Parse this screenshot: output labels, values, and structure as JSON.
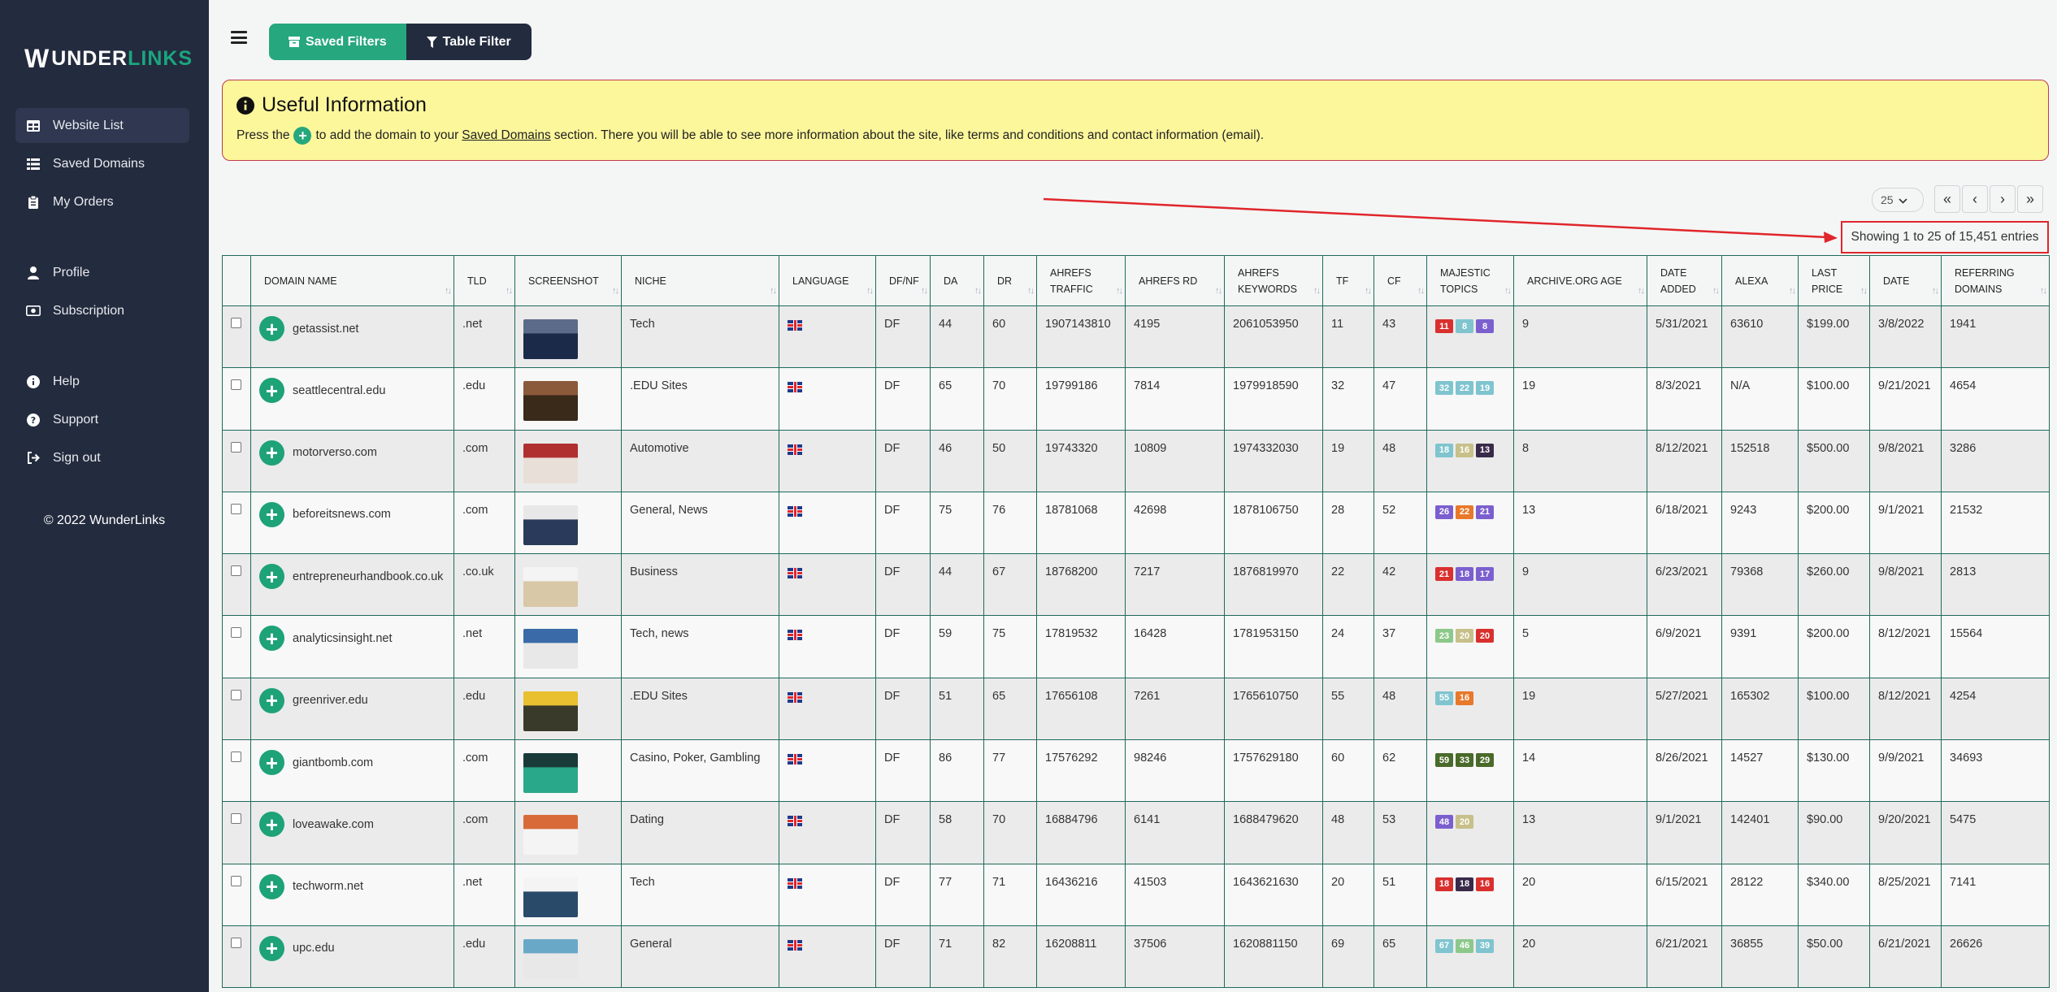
{
  "sidebar": {
    "logo": {
      "w": "W",
      "under": "UNDER",
      "links": "LINKS"
    },
    "items": [
      {
        "label": "Website List",
        "icon": "table-icon"
      },
      {
        "label": "Saved Domains",
        "icon": "list-icon"
      },
      {
        "label": "My Orders",
        "icon": "clipboard-icon"
      },
      {
        "label": "Profile",
        "icon": "user-icon"
      },
      {
        "label": "Subscription",
        "icon": "money-bill-icon"
      },
      {
        "label": "Help",
        "icon": "info-circle-icon"
      },
      {
        "label": "Support",
        "icon": "question-circle-icon"
      },
      {
        "label": "Sign out",
        "icon": "sign-out-icon"
      }
    ],
    "copyright": "© 2022 WunderLinks"
  },
  "toolbar": {
    "saved_filters": "Saved Filters",
    "table_filter": "Table Filter"
  },
  "info": {
    "title": "Useful Information",
    "text_before": "Press the",
    "text_middle": "to add the domain to your",
    "link": "Saved Domains",
    "text_after": "section. There you will be able to see more information about the site, like terms and conditions and contact information (email)."
  },
  "pagination": {
    "page_size": "25",
    "showing": "Showing 1 to 25 of 15,451 entries"
  },
  "colors": {
    "accent": "#26a77d",
    "sidebar": "#232b3e",
    "highlight": "#e0262c"
  },
  "table": {
    "headers": [
      "",
      "DOMAIN NAME",
      "TLD",
      "SCREENSHOT",
      "NICHE",
      "LANGUAGE",
      "DF/NF",
      "DA",
      "DR",
      "AHREFS TRAFFIC",
      "AHREFS RD",
      "AHREFS KEYWORDS",
      "TF",
      "CF",
      "MAJESTIC TOPICS",
      "ARCHIVE.ORG AGE",
      "DATE ADDED",
      "ALEXA",
      "LAST PRICE",
      "DATE",
      "REFERRING DOMAINS"
    ],
    "rows": [
      {
        "domain": "getassist.net",
        "tld": ".net",
        "niche": "Tech",
        "dfnf": "DF",
        "da": "44",
        "dr": "60",
        "traffic": "1907143810",
        "rd": "4195",
        "keywords": "2061053950",
        "tf": "11",
        "cf": "43",
        "topics": [
          {
            "v": "11",
            "c": "#d9302e"
          },
          {
            "v": "8",
            "c": "#7fc4cf"
          },
          {
            "v": "8",
            "c": "#7b5fcf"
          }
        ],
        "age": "9",
        "added": "5/31/2021",
        "alexa": "63610",
        "price": "$199.00",
        "date": "3/8/2022",
        "refdomains": "1941",
        "shot": [
          "#5c6b8a",
          "#1c2a4a"
        ]
      },
      {
        "domain": "seattlecentral.edu",
        "tld": ".edu",
        "niche": ".EDU Sites",
        "dfnf": "DF",
        "da": "65",
        "dr": "70",
        "traffic": "19799186",
        "rd": "7814",
        "keywords": "1979918590",
        "tf": "32",
        "cf": "47",
        "topics": [
          {
            "v": "32",
            "c": "#7fc4cf"
          },
          {
            "v": "22",
            "c": "#7fc4cf"
          },
          {
            "v": "19",
            "c": "#7fc4cf"
          }
        ],
        "age": "19",
        "added": "8/3/2021",
        "alexa": "N/A",
        "price": "$100.00",
        "date": "9/21/2021",
        "refdomains": "4654",
        "shot": [
          "#8a5a3a",
          "#3a2a1a"
        ]
      },
      {
        "domain": "motorverso.com",
        "tld": ".com",
        "niche": "Automotive",
        "dfnf": "DF",
        "da": "46",
        "dr": "50",
        "traffic": "19743320",
        "rd": "10809",
        "keywords": "1974332030",
        "tf": "19",
        "cf": "48",
        "topics": [
          {
            "v": "18",
            "c": "#7fc4cf"
          },
          {
            "v": "16",
            "c": "#c7c08a"
          },
          {
            "v": "13",
            "c": "#3a2a4a"
          }
        ],
        "age": "8",
        "added": "8/12/2021",
        "alexa": "152518",
        "price": "$500.00",
        "date": "9/8/2021",
        "refdomains": "3286",
        "shot": [
          "#b03030",
          "#e8e0d8"
        ]
      },
      {
        "domain": "beforeitsnews.com",
        "tld": ".com",
        "niche": "General, News",
        "dfnf": "DF",
        "da": "75",
        "dr": "76",
        "traffic": "18781068",
        "rd": "42698",
        "keywords": "1878106750",
        "tf": "28",
        "cf": "52",
        "topics": [
          {
            "v": "26",
            "c": "#7b5fcf"
          },
          {
            "v": "22",
            "c": "#e8782a"
          },
          {
            "v": "21",
            "c": "#7b5fcf"
          }
        ],
        "age": "13",
        "added": "6/18/2021",
        "alexa": "9243",
        "price": "$200.00",
        "date": "9/1/2021",
        "refdomains": "21532",
        "shot": [
          "#e8e8e8",
          "#2a3a5a"
        ]
      },
      {
        "domain": "entrepreneurhandbook.co.uk",
        "tld": ".co.uk",
        "niche": "Business",
        "dfnf": "DF",
        "da": "44",
        "dr": "67",
        "traffic": "18768200",
        "rd": "7217",
        "keywords": "1876819970",
        "tf": "22",
        "cf": "42",
        "topics": [
          {
            "v": "21",
            "c": "#d9302e"
          },
          {
            "v": "18",
            "c": "#7b5fcf"
          },
          {
            "v": "17",
            "c": "#7b5fcf"
          }
        ],
        "age": "9",
        "added": "6/23/2021",
        "alexa": "79368",
        "price": "$260.00",
        "date": "9/8/2021",
        "refdomains": "2813",
        "shot": [
          "#f4f4f4",
          "#d8c8a8"
        ]
      },
      {
        "domain": "analyticsinsight.net",
        "tld": ".net",
        "niche": "Tech, news",
        "dfnf": "DF",
        "da": "59",
        "dr": "75",
        "traffic": "17819532",
        "rd": "16428",
        "keywords": "1781953150",
        "tf": "24",
        "cf": "37",
        "topics": [
          {
            "v": "23",
            "c": "#8cc88a"
          },
          {
            "v": "20",
            "c": "#c7c08a"
          },
          {
            "v": "20",
            "c": "#d9302e"
          }
        ],
        "age": "5",
        "added": "6/9/2021",
        "alexa": "9391",
        "price": "$200.00",
        "date": "8/12/2021",
        "refdomains": "15564",
        "shot": [
          "#3a6aa8",
          "#e8e8e8"
        ]
      },
      {
        "domain": "greenriver.edu",
        "tld": ".edu",
        "niche": ".EDU Sites",
        "dfnf": "DF",
        "da": "51",
        "dr": "65",
        "traffic": "17656108",
        "rd": "7261",
        "keywords": "1765610750",
        "tf": "55",
        "cf": "48",
        "topics": [
          {
            "v": "55",
            "c": "#7fc4cf"
          },
          {
            "v": "16",
            "c": "#e8782a"
          }
        ],
        "age": "19",
        "added": "5/27/2021",
        "alexa": "165302",
        "price": "$100.00",
        "date": "8/12/2021",
        "refdomains": "4254",
        "shot": [
          "#e8c030",
          "#3a3a2a"
        ]
      },
      {
        "domain": "giantbomb.com",
        "tld": ".com",
        "niche": "Casino, Poker, Gambling",
        "dfnf": "DF",
        "da": "86",
        "dr": "77",
        "traffic": "17576292",
        "rd": "98246",
        "keywords": "1757629180",
        "tf": "60",
        "cf": "62",
        "topics": [
          {
            "v": "59",
            "c": "#4a6a2a"
          },
          {
            "v": "33",
            "c": "#4a6a2a"
          },
          {
            "v": "29",
            "c": "#4a6a2a"
          }
        ],
        "age": "14",
        "added": "8/26/2021",
        "alexa": "14527",
        "price": "$130.00",
        "date": "9/9/2021",
        "refdomains": "34693",
        "shot": [
          "#1a3a3a",
          "#2aa88a"
        ]
      },
      {
        "domain": "loveawake.com",
        "tld": ".com",
        "niche": "Dating",
        "dfnf": "DF",
        "da": "58",
        "dr": "70",
        "traffic": "16884796",
        "rd": "6141",
        "keywords": "1688479620",
        "tf": "48",
        "cf": "53",
        "topics": [
          {
            "v": "48",
            "c": "#7b5fcf"
          },
          {
            "v": "20",
            "c": "#c7c08a"
          }
        ],
        "age": "13",
        "added": "9/1/2021",
        "alexa": "142401",
        "price": "$90.00",
        "date": "9/20/2021",
        "refdomains": "5475",
        "shot": [
          "#d86a3a",
          "#f4f4f4"
        ]
      },
      {
        "domain": "techworm.net",
        "tld": ".net",
        "niche": "Tech",
        "dfnf": "DF",
        "da": "77",
        "dr": "71",
        "traffic": "16436216",
        "rd": "41503",
        "keywords": "1643621630",
        "tf": "20",
        "cf": "51",
        "topics": [
          {
            "v": "18",
            "c": "#d9302e"
          },
          {
            "v": "18",
            "c": "#3a2a4a"
          },
          {
            "v": "16",
            "c": "#d9302e"
          }
        ],
        "age": "20",
        "added": "6/15/2021",
        "alexa": "28122",
        "price": "$340.00",
        "date": "8/25/2021",
        "refdomains": "7141",
        "shot": [
          "#f4f4f4",
          "#2a4a6a"
        ]
      },
      {
        "domain": "upc.edu",
        "tld": ".edu",
        "niche": "General",
        "dfnf": "DF",
        "da": "71",
        "dr": "82",
        "traffic": "16208811",
        "rd": "37506",
        "keywords": "1620881150",
        "tf": "69",
        "cf": "65",
        "topics": [
          {
            "v": "67",
            "c": "#7fc4cf"
          },
          {
            "v": "46",
            "c": "#8cc88a"
          },
          {
            "v": "39",
            "c": "#7fc4cf"
          }
        ],
        "age": "20",
        "added": "6/21/2021",
        "alexa": "36855",
        "price": "$50.00",
        "date": "6/21/2021",
        "refdomains": "26626",
        "shot": [
          "#6aa8c8",
          "#e8e8e8"
        ]
      }
    ]
  }
}
